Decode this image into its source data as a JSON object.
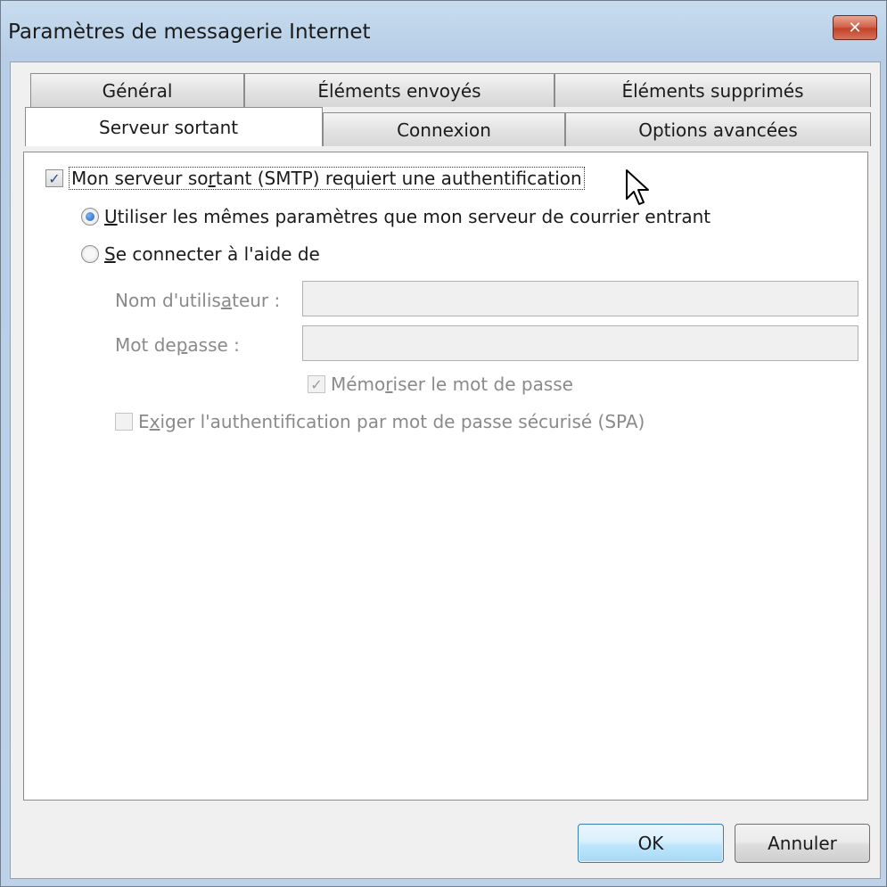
{
  "window": {
    "title": "Paramètres de messagerie Internet",
    "close_glyph": "✕"
  },
  "tabs": {
    "row1": [
      {
        "label": "Général"
      },
      {
        "label": "Éléments envoyés"
      },
      {
        "label": "Éléments supprimés"
      }
    ],
    "row2": [
      {
        "label": "Serveur sortant",
        "active": true
      },
      {
        "label": "Connexion",
        "active": false
      },
      {
        "label": "Options avancées",
        "active": false
      }
    ]
  },
  "panel": {
    "smtp_auth": {
      "checked": true,
      "label_before": "Mon serveur so",
      "label_mnemonic": "r",
      "label_after": "tant (SMTP) requiert une authentification"
    },
    "use_same": {
      "selected": true,
      "mnemonic": "U",
      "label_after": "tiliser les mêmes paramètres que mon serveur de courrier entrant"
    },
    "connect_with": {
      "selected": false,
      "mnemonic": "S",
      "label_after": "e connecter à l'aide de"
    },
    "username": {
      "label_before": "Nom d'utilis",
      "label_mnemonic": "a",
      "label_after": "teur :",
      "value": ""
    },
    "password": {
      "label_before": "Mot de ",
      "label_mnemonic": "p",
      "label_after": "asse :",
      "value": ""
    },
    "remember_password": {
      "checked": true,
      "label_before": "Mémo",
      "label_mnemonic": "r",
      "label_after": "iser le mot de passe"
    },
    "require_spa": {
      "checked": false,
      "label_before": "E",
      "label_mnemonic": "x",
      "label_after": "iger l'authentification par mot de passe sécurisé (SPA)"
    }
  },
  "buttons": {
    "ok": "OK",
    "cancel": "Annuler"
  },
  "icons": {
    "checkmark": "✓",
    "cursor": "arrow-cursor-icon"
  }
}
